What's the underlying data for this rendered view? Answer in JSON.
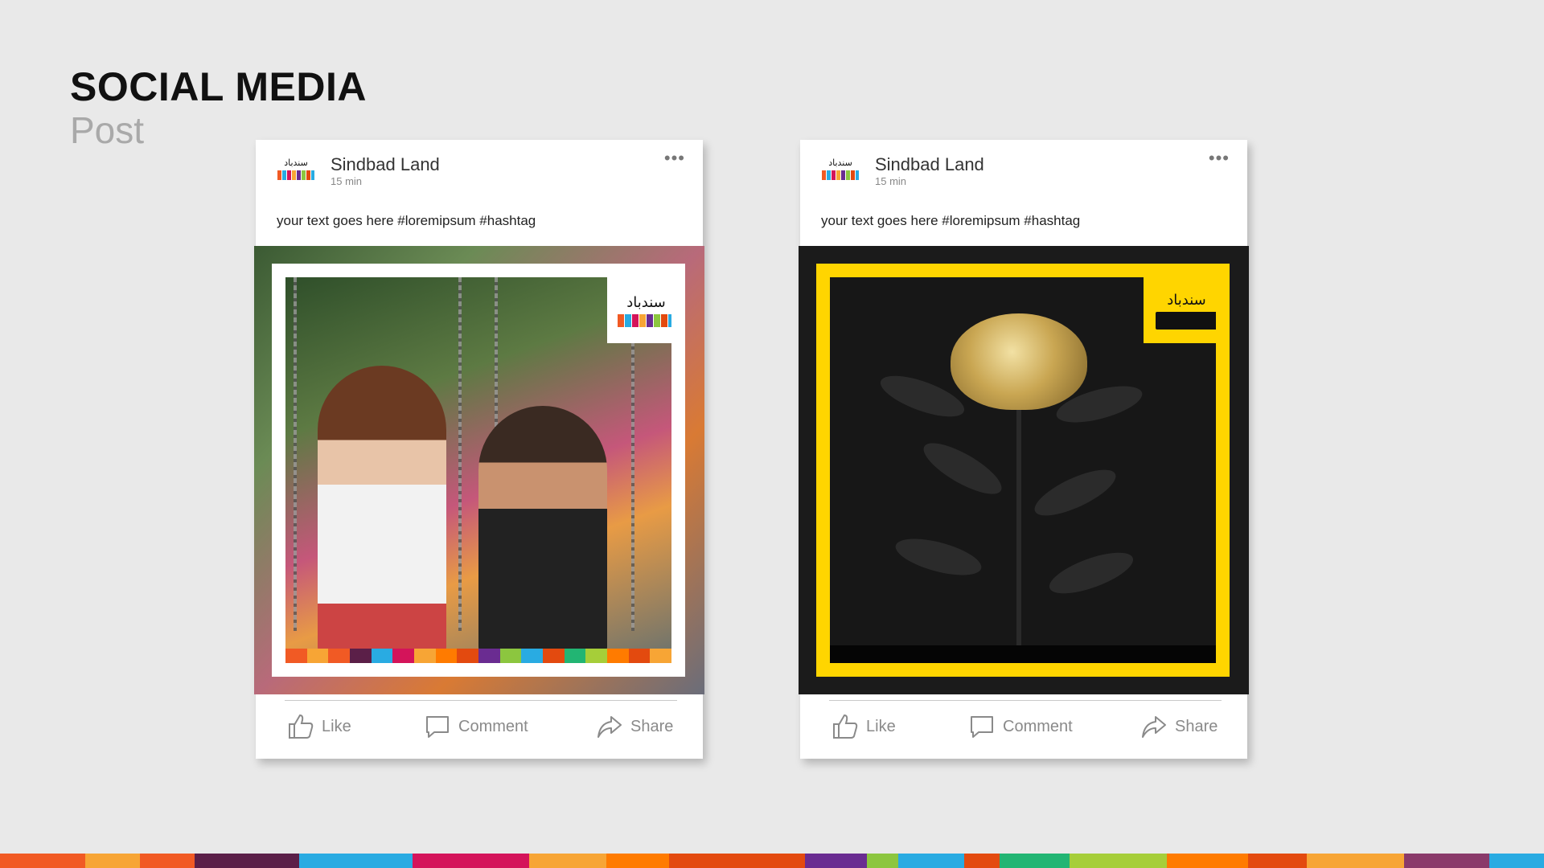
{
  "heading": {
    "title": "SOCIAL MEDIA",
    "subtitle": "Post"
  },
  "posts": [
    {
      "author": "Sindbad Land",
      "time": "15 min",
      "caption": "your text goes here #loremipsum #hashtag",
      "more": "•••",
      "logo_text": "سندباد",
      "actions": {
        "like": "Like",
        "comment": "Comment",
        "share": "Share"
      }
    },
    {
      "author": "Sindbad Land",
      "time": "15 min",
      "caption": "your text goes here #loremipsum #hashtag",
      "more": "•••",
      "logo_text": "سندباد",
      "actions": {
        "like": "Like",
        "comment": "Comment",
        "share": "Share"
      }
    }
  ],
  "colors": {
    "background": "#e9e9e9",
    "brand_yellow": "#ffd500",
    "icon_gray": "#8a8a8a",
    "strip": [
      "#f15a24",
      "#f7a535",
      "#f15a24",
      "#5b1f48",
      "#29abe2",
      "#d4145a",
      "#f7a535",
      "#ff7b00",
      "#e34a0f",
      "#6a2c91",
      "#8cc63f",
      "#29abe2",
      "#e34a0f",
      "#22b573",
      "#a6ce39",
      "#ff7b00",
      "#e34a0f",
      "#f7a535",
      "#8a3a6a",
      "#29abe2"
    ]
  }
}
